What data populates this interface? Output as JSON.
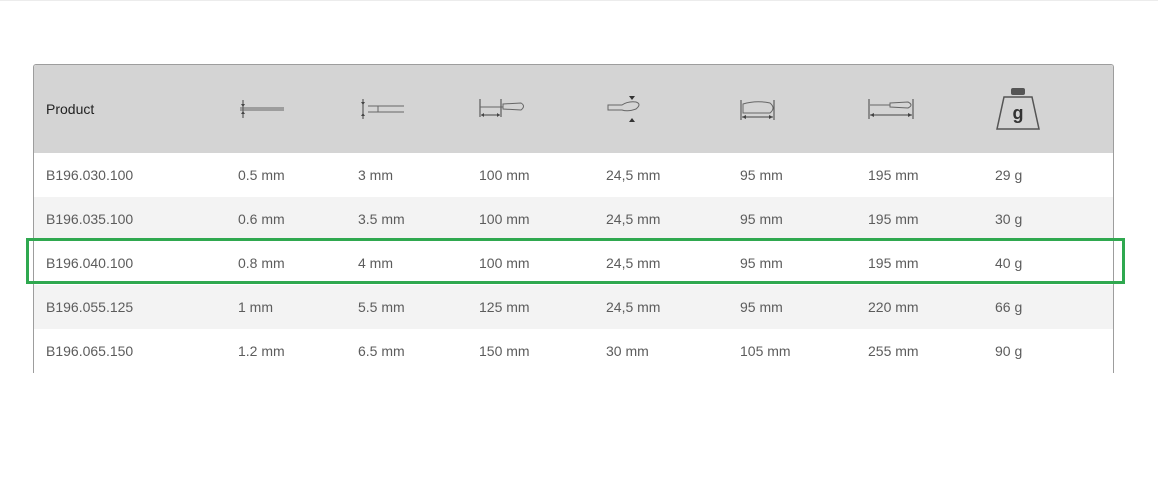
{
  "table": {
    "header": {
      "product_label": "Product",
      "icons": [
        "blade-thickness-icon",
        "blade-width-icon",
        "blade-length-icon",
        "handle-diameter-icon",
        "handle-length-icon",
        "total-length-icon",
        "weight-icon"
      ],
      "weight_icon_letter": "g"
    },
    "rows": [
      [
        "B196.030.100",
        "0.5 mm",
        "3 mm",
        "100 mm",
        "24,5 mm",
        "95 mm",
        "195 mm",
        "29 g"
      ],
      [
        "B196.035.100",
        "0.6 mm",
        "3.5 mm",
        "100 mm",
        "24,5 mm",
        "95 mm",
        "195 mm",
        "30 g"
      ],
      [
        "B196.040.100",
        "0.8 mm",
        "4 mm",
        "100 mm",
        "24,5 mm",
        "95 mm",
        "195 mm",
        "40 g"
      ],
      [
        "B196.055.125",
        "1 mm",
        "5.5 mm",
        "125 mm",
        "24,5 mm",
        "95 mm",
        "220 mm",
        "66 g"
      ],
      [
        "B196.065.150",
        "1.2 mm",
        "6.5 mm",
        "150 mm",
        "30 mm",
        "105 mm",
        "255 mm",
        "90 g"
      ]
    ],
    "highlighted_row": 2
  },
  "colors": {
    "header_bg": "#d4d4d4",
    "row_alt_bg": "#f3f3f3",
    "highlight": "#2fa84f"
  }
}
